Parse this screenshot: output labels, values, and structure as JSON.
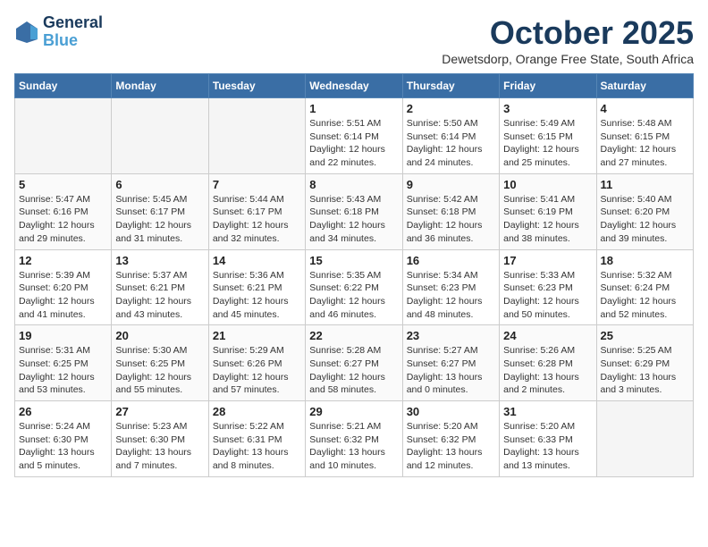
{
  "header": {
    "logo_line1": "General",
    "logo_line2": "Blue",
    "month": "October 2025",
    "location": "Dewetsdorp, Orange Free State, South Africa"
  },
  "days_of_week": [
    "Sunday",
    "Monday",
    "Tuesday",
    "Wednesday",
    "Thursday",
    "Friday",
    "Saturday"
  ],
  "weeks": [
    [
      {
        "day": "",
        "info": ""
      },
      {
        "day": "",
        "info": ""
      },
      {
        "day": "",
        "info": ""
      },
      {
        "day": "1",
        "info": "Sunrise: 5:51 AM\nSunset: 6:14 PM\nDaylight: 12 hours\nand 22 minutes."
      },
      {
        "day": "2",
        "info": "Sunrise: 5:50 AM\nSunset: 6:14 PM\nDaylight: 12 hours\nand 24 minutes."
      },
      {
        "day": "3",
        "info": "Sunrise: 5:49 AM\nSunset: 6:15 PM\nDaylight: 12 hours\nand 25 minutes."
      },
      {
        "day": "4",
        "info": "Sunrise: 5:48 AM\nSunset: 6:15 PM\nDaylight: 12 hours\nand 27 minutes."
      }
    ],
    [
      {
        "day": "5",
        "info": "Sunrise: 5:47 AM\nSunset: 6:16 PM\nDaylight: 12 hours\nand 29 minutes."
      },
      {
        "day": "6",
        "info": "Sunrise: 5:45 AM\nSunset: 6:17 PM\nDaylight: 12 hours\nand 31 minutes."
      },
      {
        "day": "7",
        "info": "Sunrise: 5:44 AM\nSunset: 6:17 PM\nDaylight: 12 hours\nand 32 minutes."
      },
      {
        "day": "8",
        "info": "Sunrise: 5:43 AM\nSunset: 6:18 PM\nDaylight: 12 hours\nand 34 minutes."
      },
      {
        "day": "9",
        "info": "Sunrise: 5:42 AM\nSunset: 6:18 PM\nDaylight: 12 hours\nand 36 minutes."
      },
      {
        "day": "10",
        "info": "Sunrise: 5:41 AM\nSunset: 6:19 PM\nDaylight: 12 hours\nand 38 minutes."
      },
      {
        "day": "11",
        "info": "Sunrise: 5:40 AM\nSunset: 6:20 PM\nDaylight: 12 hours\nand 39 minutes."
      }
    ],
    [
      {
        "day": "12",
        "info": "Sunrise: 5:39 AM\nSunset: 6:20 PM\nDaylight: 12 hours\nand 41 minutes."
      },
      {
        "day": "13",
        "info": "Sunrise: 5:37 AM\nSunset: 6:21 PM\nDaylight: 12 hours\nand 43 minutes."
      },
      {
        "day": "14",
        "info": "Sunrise: 5:36 AM\nSunset: 6:21 PM\nDaylight: 12 hours\nand 45 minutes."
      },
      {
        "day": "15",
        "info": "Sunrise: 5:35 AM\nSunset: 6:22 PM\nDaylight: 12 hours\nand 46 minutes."
      },
      {
        "day": "16",
        "info": "Sunrise: 5:34 AM\nSunset: 6:23 PM\nDaylight: 12 hours\nand 48 minutes."
      },
      {
        "day": "17",
        "info": "Sunrise: 5:33 AM\nSunset: 6:23 PM\nDaylight: 12 hours\nand 50 minutes."
      },
      {
        "day": "18",
        "info": "Sunrise: 5:32 AM\nSunset: 6:24 PM\nDaylight: 12 hours\nand 52 minutes."
      }
    ],
    [
      {
        "day": "19",
        "info": "Sunrise: 5:31 AM\nSunset: 6:25 PM\nDaylight: 12 hours\nand 53 minutes."
      },
      {
        "day": "20",
        "info": "Sunrise: 5:30 AM\nSunset: 6:25 PM\nDaylight: 12 hours\nand 55 minutes."
      },
      {
        "day": "21",
        "info": "Sunrise: 5:29 AM\nSunset: 6:26 PM\nDaylight: 12 hours\nand 57 minutes."
      },
      {
        "day": "22",
        "info": "Sunrise: 5:28 AM\nSunset: 6:27 PM\nDaylight: 12 hours\nand 58 minutes."
      },
      {
        "day": "23",
        "info": "Sunrise: 5:27 AM\nSunset: 6:27 PM\nDaylight: 13 hours\nand 0 minutes."
      },
      {
        "day": "24",
        "info": "Sunrise: 5:26 AM\nSunset: 6:28 PM\nDaylight: 13 hours\nand 2 minutes."
      },
      {
        "day": "25",
        "info": "Sunrise: 5:25 AM\nSunset: 6:29 PM\nDaylight: 13 hours\nand 3 minutes."
      }
    ],
    [
      {
        "day": "26",
        "info": "Sunrise: 5:24 AM\nSunset: 6:30 PM\nDaylight: 13 hours\nand 5 minutes."
      },
      {
        "day": "27",
        "info": "Sunrise: 5:23 AM\nSunset: 6:30 PM\nDaylight: 13 hours\nand 7 minutes."
      },
      {
        "day": "28",
        "info": "Sunrise: 5:22 AM\nSunset: 6:31 PM\nDaylight: 13 hours\nand 8 minutes."
      },
      {
        "day": "29",
        "info": "Sunrise: 5:21 AM\nSunset: 6:32 PM\nDaylight: 13 hours\nand 10 minutes."
      },
      {
        "day": "30",
        "info": "Sunrise: 5:20 AM\nSunset: 6:32 PM\nDaylight: 13 hours\nand 12 minutes."
      },
      {
        "day": "31",
        "info": "Sunrise: 5:20 AM\nSunset: 6:33 PM\nDaylight: 13 hours\nand 13 minutes."
      },
      {
        "day": "",
        "info": ""
      }
    ]
  ]
}
